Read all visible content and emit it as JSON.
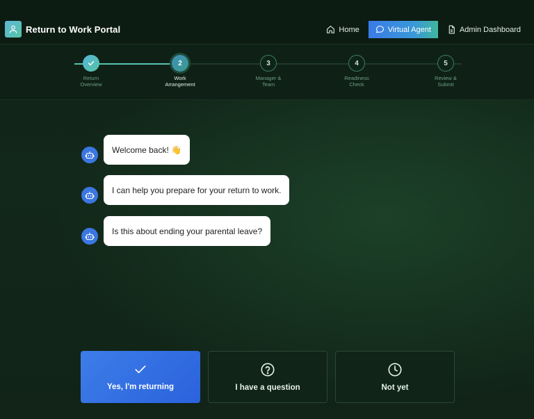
{
  "header": {
    "title": "Return to Work Portal",
    "nav": {
      "home": "Home",
      "virtual_agent": "Virtual Agent",
      "admin": "Admin Dashboard"
    }
  },
  "steps": [
    {
      "number": "✓",
      "label_line1": "Return",
      "label_line2": "Overview",
      "status": "done"
    },
    {
      "number": "2",
      "label_line1": "Work",
      "label_line2": "Arrangement",
      "status": "current"
    },
    {
      "number": "3",
      "label_line1": "Manager &",
      "label_line2": "Team",
      "status": "pending"
    },
    {
      "number": "4",
      "label_line1": "Readiness",
      "label_line2": "Check",
      "status": "pending"
    },
    {
      "number": "5",
      "label_line1": "Review &",
      "label_line2": "Submit",
      "status": "pending"
    }
  ],
  "messages": [
    {
      "text": "Welcome back! 👋"
    },
    {
      "text": "I can help you prepare for your return to work."
    },
    {
      "text": "Is this about ending your parental leave?"
    }
  ],
  "options": [
    {
      "label": "Yes, I'm returning",
      "icon": "check-icon"
    },
    {
      "label": "I have a question",
      "icon": "question-circle-icon"
    },
    {
      "label": "Not yet",
      "icon": "clock-icon"
    }
  ],
  "colors": {
    "accent_blue": "#3b76e1",
    "accent_teal": "#56c3b0",
    "background": "#12281a"
  }
}
